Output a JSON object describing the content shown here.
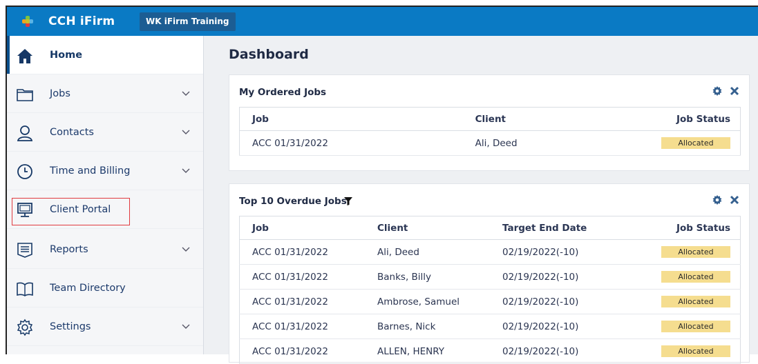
{
  "app": {
    "title": "CCH iFirm",
    "tenant": "WK iFirm Training"
  },
  "sidebar": {
    "items": [
      {
        "label": "Home",
        "icon": "home-icon",
        "expandable": false,
        "active": true
      },
      {
        "label": "Jobs",
        "icon": "folder-icon",
        "expandable": true
      },
      {
        "label": "Contacts",
        "icon": "person-icon",
        "expandable": true
      },
      {
        "label": "Time and Billing",
        "icon": "clock-icon",
        "expandable": true
      },
      {
        "label": "Client Portal",
        "icon": "monitor-icon",
        "expandable": false,
        "highlighted": true
      },
      {
        "label": "Reports",
        "icon": "report-icon",
        "expandable": true
      },
      {
        "label": "Team Directory",
        "icon": "book-icon",
        "expandable": false
      },
      {
        "label": "Settings",
        "icon": "gear-icon",
        "expandable": true
      }
    ]
  },
  "dashboard": {
    "title": "Dashboard",
    "my_ordered_jobs": {
      "title": "My Ordered Jobs",
      "columns": [
        "Job",
        "Client",
        "Job Status"
      ],
      "rows": [
        {
          "job": "ACC 01/31/2022",
          "client": "Ali, Deed",
          "status": "Allocated"
        }
      ]
    },
    "top_overdue": {
      "title": "Top 10 Overdue Jobs",
      "columns": [
        "Job",
        "Client",
        "Target End Date",
        "Job Status"
      ],
      "rows": [
        {
          "job": "ACC 01/31/2022",
          "client": "Ali, Deed",
          "target": "02/19/2022(-10)",
          "status": "Allocated"
        },
        {
          "job": "ACC 01/31/2022",
          "client": "Banks, Billy",
          "target": "02/19/2022(-10)",
          "status": "Allocated"
        },
        {
          "job": "ACC 01/31/2022",
          "client": "Ambrose, Samuel",
          "target": "02/19/2022(-10)",
          "status": "Allocated"
        },
        {
          "job": "ACC 01/31/2022",
          "client": "Barnes, Nick",
          "target": "02/19/2022(-10)",
          "status": "Allocated"
        },
        {
          "job": "ACC 01/31/2022",
          "client": "ALLEN, HENRY",
          "target": "02/19/2022(-10)",
          "status": "Allocated"
        }
      ]
    }
  },
  "colors": {
    "topbar": "#0a7ac4",
    "tenant_badge": "#1c5d93",
    "status_allocated": "#f5dd8f",
    "highlight": "#e0393e"
  }
}
